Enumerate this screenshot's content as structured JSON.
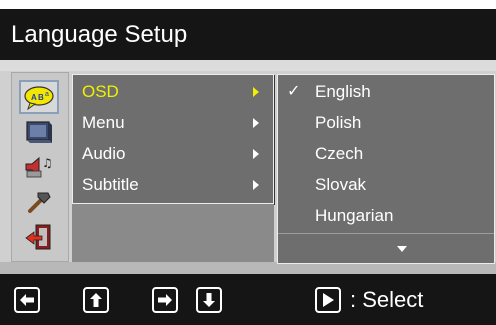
{
  "title": "Language Setup",
  "menu": {
    "items": [
      {
        "label": "OSD",
        "active": true
      },
      {
        "label": "Menu",
        "active": false
      },
      {
        "label": "Audio",
        "active": false
      },
      {
        "label": "Subtitle",
        "active": false
      }
    ]
  },
  "submenu": {
    "items": [
      {
        "label": "English",
        "checked": true
      },
      {
        "label": "Polish",
        "checked": false
      },
      {
        "label": "Czech",
        "checked": false
      },
      {
        "label": "Slovak",
        "checked": false
      },
      {
        "label": "Hungarian",
        "checked": false
      }
    ],
    "check_mark": "✓"
  },
  "footer": {
    "select_label": ": Select"
  },
  "colors": {
    "active_text": "#f0f000",
    "bar_background": "#151515"
  }
}
